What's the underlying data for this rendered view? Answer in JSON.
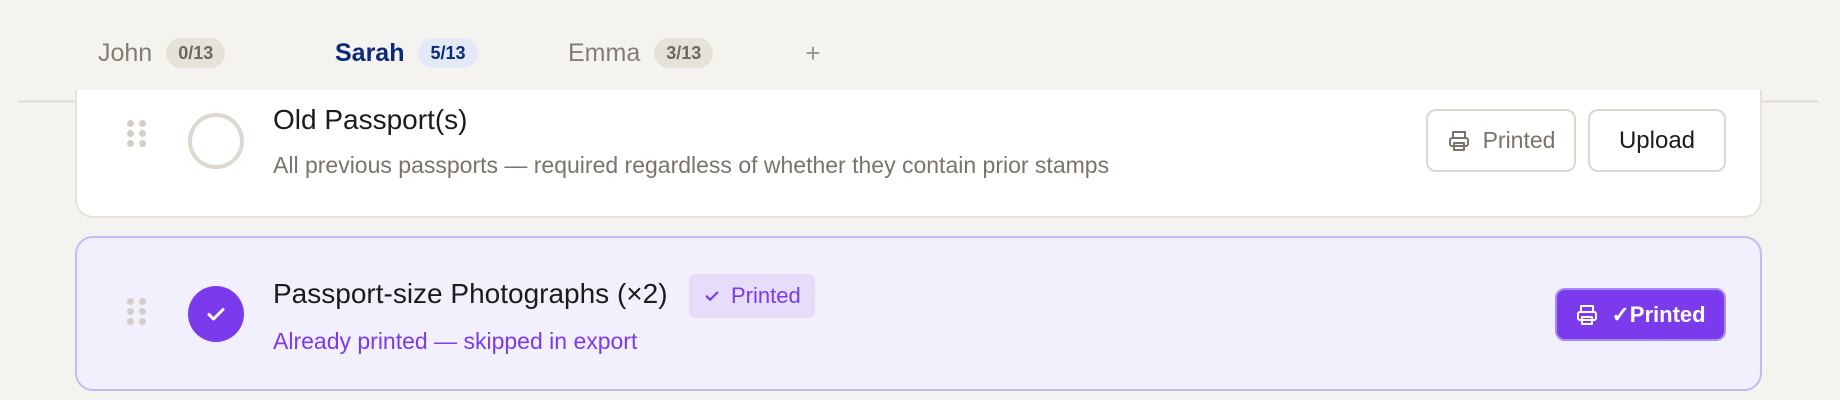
{
  "tabs": [
    {
      "label": "John",
      "badge": "0/13",
      "active": false
    },
    {
      "label": "Sarah",
      "badge": "5/13",
      "active": true
    },
    {
      "label": "Emma",
      "badge": "3/13",
      "active": false
    }
  ],
  "add_tab_label": "+",
  "items": [
    {
      "title": "Old Passport(s)",
      "subtitle": "All previous passports — required regardless of whether they contain prior stamps",
      "checked": false,
      "print_button_label": "Printed",
      "upload_button_label": "Upload"
    },
    {
      "title": "Passport-size Photographs (×2)",
      "tag_label": "Printed",
      "subtitle": "Already printed — skipped in export",
      "checked": true,
      "printed_button_label": "✓Printed"
    }
  ],
  "icons": {
    "drag": "drag-handle-icon",
    "printer": "printer-icon",
    "check": "check-icon"
  },
  "colors": {
    "accent": "#7c3aed",
    "active_tab": "#0b2a7c",
    "page_bg": "#f5f3ef",
    "checked_card_bg": "#f3f0fe"
  }
}
